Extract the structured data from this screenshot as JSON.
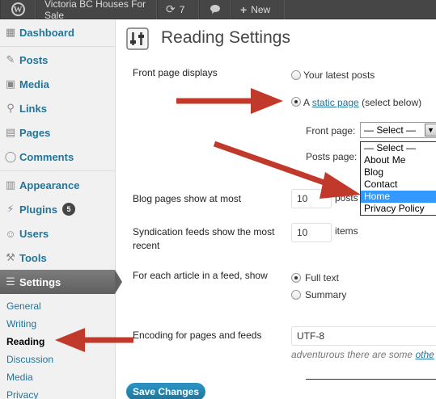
{
  "adminbar": {
    "site_name": "Victoria BC Houses For Sale",
    "updates_count": "7",
    "new_label": "New"
  },
  "sidebar": {
    "items": [
      {
        "label": "Dashboard",
        "icon": "dashboard-icon"
      },
      {
        "label": "Posts",
        "icon": "pin-icon"
      },
      {
        "label": "Media",
        "icon": "media-icon"
      },
      {
        "label": "Links",
        "icon": "link-icon"
      },
      {
        "label": "Pages",
        "icon": "pages-icon"
      },
      {
        "label": "Comments",
        "icon": "comment-icon"
      },
      {
        "label": "Appearance",
        "icon": "appearance-icon"
      },
      {
        "label": "Plugins",
        "icon": "plugin-icon",
        "badge": "5"
      },
      {
        "label": "Users",
        "icon": "users-icon"
      },
      {
        "label": "Tools",
        "icon": "tools-icon"
      },
      {
        "label": "Settings",
        "icon": "settings-icon"
      }
    ],
    "submenu": [
      "General",
      "Writing",
      "Reading",
      "Discussion",
      "Media",
      "Privacy"
    ]
  },
  "page": {
    "title": "Reading Settings",
    "front_page_displays": {
      "label": "Front page displays",
      "option_latest": "Your latest posts",
      "option_static_prefix": "A",
      "option_static_link": "static page",
      "option_static_suffix": "(select below)",
      "front_page_label": "Front page:",
      "front_page_selected": "— Select —",
      "posts_page_label": "Posts page:",
      "dropdown_options": [
        "— Select —",
        "About Me",
        "Blog",
        "Contact",
        "Home",
        "Privacy Policy"
      ],
      "highlighted_option": "Home"
    },
    "blog_pages": {
      "label": "Blog pages show at most",
      "value": "10",
      "unit": "posts"
    },
    "syndication": {
      "label": "Syndication feeds show the most recent",
      "value": "10",
      "unit": "items"
    },
    "feed_article": {
      "label": "For each article in a feed, show",
      "option_full": "Full text",
      "option_summary": "Summary"
    },
    "encoding": {
      "label": "Encoding for pages and feeds",
      "value": "UTF-8",
      "note_prefix": "adventurous there are some",
      "note_link": "othe"
    },
    "save_label": "Save Changes"
  },
  "colors": {
    "link": "#21759b",
    "arrow": "#c0392b",
    "adminbar": "#464646"
  }
}
